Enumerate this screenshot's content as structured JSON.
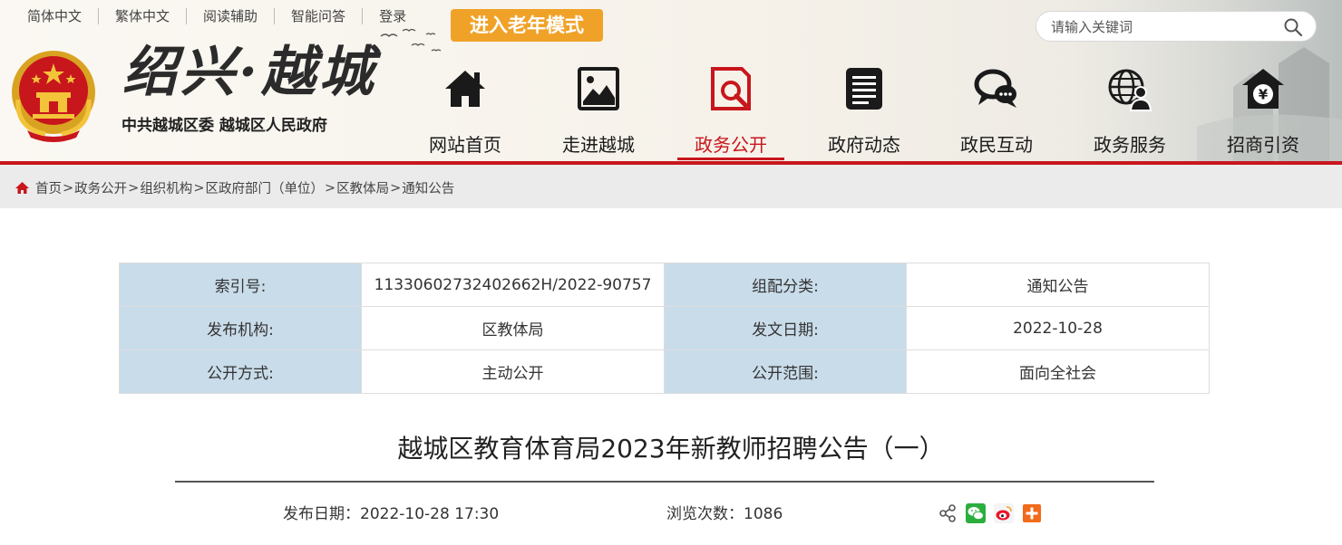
{
  "topbar": {
    "links": [
      "简体中文",
      "繁体中文",
      "阅读辅助",
      "智能问答",
      "登录"
    ],
    "elder_mode": "进入老年模式"
  },
  "search": {
    "placeholder": "请输入关键词"
  },
  "site": {
    "calligraphy": "绍兴·越城",
    "subtitle": "中共越城区委 越城区人民政府"
  },
  "nav": [
    {
      "label": "网站首页",
      "icon": "home-icon"
    },
    {
      "label": "走进越城",
      "icon": "picture-icon"
    },
    {
      "label": "政务公开",
      "icon": "document-search-icon",
      "active": true
    },
    {
      "label": "政府动态",
      "icon": "news-icon"
    },
    {
      "label": "政民互动",
      "icon": "chat-icon"
    },
    {
      "label": "政务服务",
      "icon": "globe-user-icon"
    },
    {
      "label": "招商引资",
      "icon": "yen-house-icon"
    }
  ],
  "breadcrumb": [
    "首页",
    "政务公开",
    "组织机构",
    "区政府部门（单位）",
    "区教体局",
    "通知公告"
  ],
  "info": {
    "index_label": "索引号:",
    "index_value": "11330602732402662H/2022-90757",
    "category_label": "组配分类:",
    "category_value": "通知公告",
    "org_label": "发布机构:",
    "org_value": "区教体局",
    "date_label": "发文日期:",
    "date_value": "2022-10-28",
    "method_label": "公开方式:",
    "method_value": "主动公开",
    "scope_label": "公开范围:",
    "scope_value": "面向全社会"
  },
  "article": {
    "title": "越城区教育体育局2023年新教师招聘公告（一）",
    "publish": "发布日期：2022-10-28 17:30",
    "views": "浏览次数：1086"
  },
  "colors": {
    "accent": "#c8161d",
    "elder": "#f0a228",
    "table_key": "#c9dcea"
  }
}
